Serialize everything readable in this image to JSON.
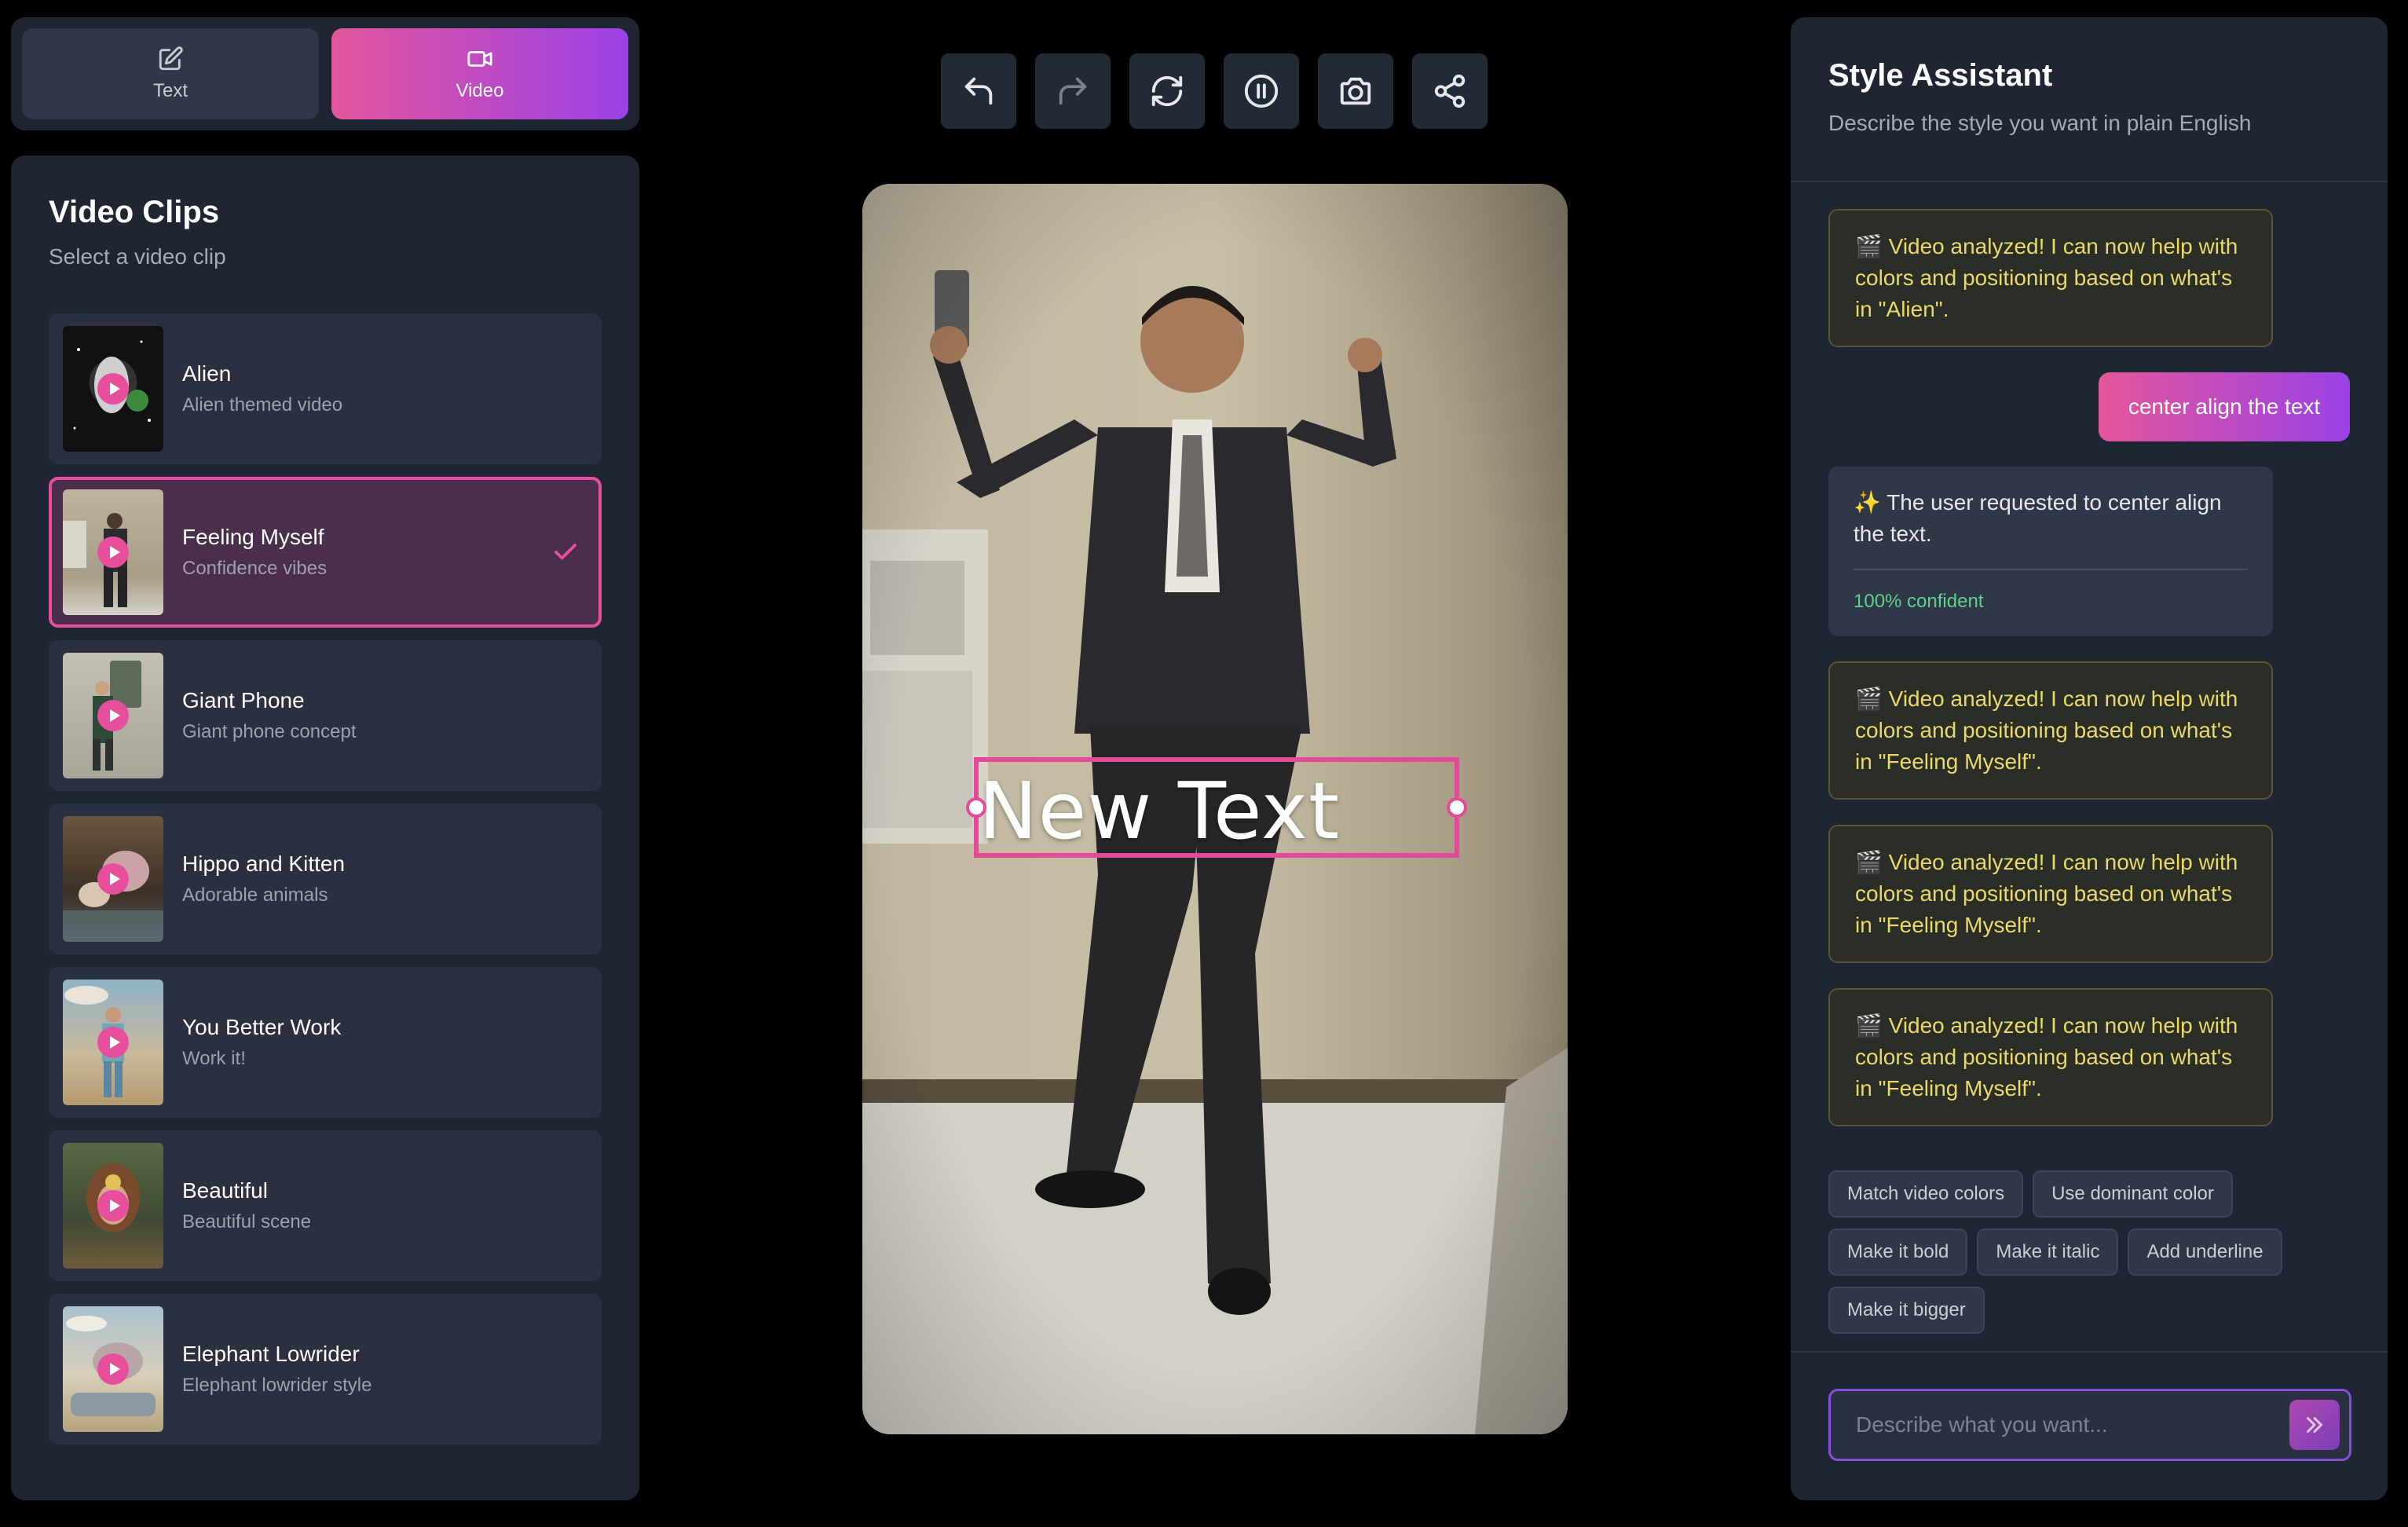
{
  "mode_switch": {
    "text_label": "Text",
    "video_label": "Video",
    "active": "Video",
    "accent_gradient": [
      "#e4569b",
      "#9b41e6"
    ]
  },
  "clips_panel": {
    "title": "Video Clips",
    "subtitle": "Select a video clip",
    "clips": [
      {
        "name": "Alien",
        "desc": "Alien themed video",
        "selected": false
      },
      {
        "name": "Feeling Myself",
        "desc": "Confidence vibes",
        "selected": true
      },
      {
        "name": "Giant Phone",
        "desc": "Giant phone concept",
        "selected": false
      },
      {
        "name": "Hippo and Kitten",
        "desc": "Adorable animals",
        "selected": false
      },
      {
        "name": "You Better Work",
        "desc": "Work it!",
        "selected": false
      },
      {
        "name": "Beautiful",
        "desc": "Beautiful scene",
        "selected": false
      },
      {
        "name": "Elephant Lowrider",
        "desc": "Elephant lowrider style",
        "selected": false
      }
    ]
  },
  "toolbar": {
    "buttons": [
      "undo-icon",
      "redo-icon",
      "refresh-icon",
      "pause-icon",
      "camera-icon",
      "share-icon"
    ]
  },
  "preview": {
    "overlay_text": "New Text",
    "selection_color": "#e34b9a"
  },
  "assistant": {
    "title": "Style Assistant",
    "subtitle": "Describe the style you want in plain English",
    "messages": {
      "m1": "🎬 Video analyzed! I can now help with colors and positioning based on what's in \"Alien\".",
      "m2": "center align the text",
      "m3": "✨ The user requested to center align the text.",
      "m3_confidence": "100% confident",
      "m4": "🎬 Video analyzed! I can now help with colors and positioning based on what's in \"Feeling Myself\".",
      "m5": "🎬 Video analyzed! I can now help with colors and positioning based on what's in \"Feeling Myself\".",
      "m6": "🎬 Video analyzed! I can now help with colors and positioning based on what's in \"Feeling Myself\"."
    },
    "suggestions": [
      "Match video colors",
      "Use dominant color",
      "Make it bold",
      "Make it italic",
      "Add underline",
      "Make it bigger"
    ],
    "input_placeholder": "Describe what you want..."
  }
}
